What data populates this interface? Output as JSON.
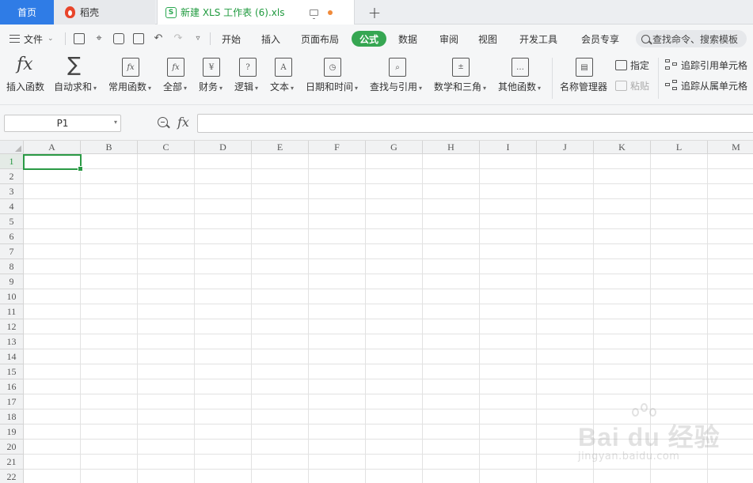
{
  "tabs": {
    "home": "首页",
    "daoke": "稻壳",
    "file": "新建 XLS 工作表 (6).xls",
    "file_icon_letter": "S",
    "new_tab": "+"
  },
  "menu": {
    "file_menu": "文件",
    "items": [
      "开始",
      "插入",
      "页面布局",
      "公式",
      "数据",
      "审阅",
      "视图",
      "开发工具",
      "会员专享"
    ],
    "active": "公式",
    "search_placeholder": "查找命令、搜索模板"
  },
  "ribbon": {
    "insert_function": "插入函数",
    "autosum": "自动求和",
    "common_functions": "常用函数",
    "all": "全部",
    "finance": "财务",
    "logic": "逻辑",
    "text": "文本",
    "datetime": "日期和时间",
    "lookup": "查找与引用",
    "math": "数学和三角",
    "other": "其他函数",
    "name_manager": "名称管理器",
    "specify": "指定",
    "paste": "粘贴",
    "trace_precedents": "追踪引用单元格",
    "trace_dependents": "追踪从属单元格"
  },
  "formula_bar": {
    "name_box": "P1",
    "fx": "fx",
    "formula": ""
  },
  "sheet": {
    "columns": [
      "A",
      "B",
      "C",
      "D",
      "E",
      "F",
      "G",
      "H",
      "I",
      "J",
      "K",
      "L",
      "M"
    ],
    "rows": [
      "1",
      "2",
      "3",
      "4",
      "5",
      "6",
      "7",
      "8",
      "9",
      "10",
      "11",
      "12",
      "13",
      "14",
      "15",
      "16",
      "17",
      "18",
      "19",
      "20",
      "21",
      "22"
    ],
    "selected_row": "1"
  },
  "watermark": {
    "brand": "Bai du 经验",
    "url": "jingyan.baidu.com"
  },
  "colors": {
    "accent_green": "#36a652",
    "home_tab_blue": "#2f7ce6",
    "modified_dot": "#f08a3a"
  }
}
